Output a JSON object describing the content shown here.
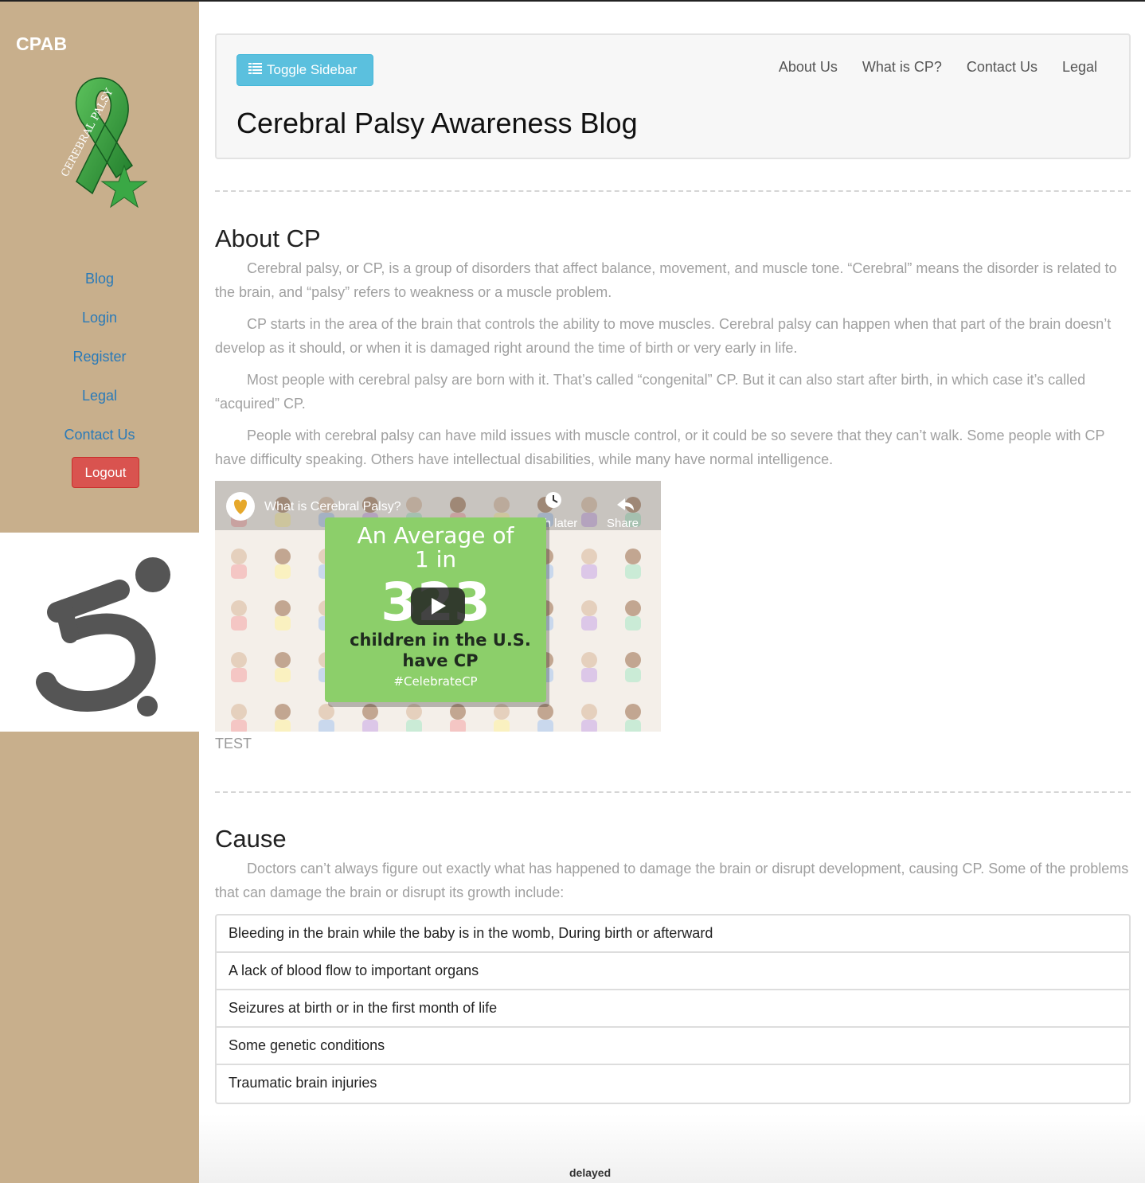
{
  "sidebar": {
    "brand": "CPAB",
    "nav": [
      {
        "label": "Blog"
      },
      {
        "label": "Login"
      },
      {
        "label": "Register"
      },
      {
        "label": "Legal"
      },
      {
        "label": "Contact Us"
      }
    ],
    "logout_label": "Logout",
    "ribbon_text": "CEREBRAL PALSY"
  },
  "header": {
    "toggle_label": "Toggle Sidebar",
    "nav": [
      "About Us",
      "What is CP?",
      "Contact Us",
      "Legal"
    ],
    "title": "Cerebral Palsy Awareness Blog"
  },
  "about": {
    "heading": "About CP",
    "paragraphs": [
      "Cerebral palsy, or CP, is a group of disorders that affect balance, movement, and muscle tone. “Cerebral” means the disorder is related to the brain, and “palsy” refers to weakness or a muscle problem.",
      "CP starts in the area of the brain that controls the ability to move muscles. Cerebral palsy can happen when that part of the brain doesn’t develop as it should, or when it is damaged right around the time of birth or very early in life.",
      "Most people with cerebral palsy are born with it. That’s called “congenital” CP. But it can also start after birth, in which case it’s called “acquired” CP.",
      "People with cerebral palsy can have mild issues with muscle control, or it could be so severe that they can’t walk. Some people with CP have difficulty speaking. Others have intellectual disabilities, while many have normal intelligence."
    ],
    "video": {
      "title": "What is Cerebral Palsy?",
      "watch_later": "Watch later",
      "share": "Share",
      "line1": "An Average of",
      "line2": "1 in",
      "number": "323",
      "line3": "children in the U.S.",
      "line4": "have CP",
      "hashtag": "#CelebrateCP"
    },
    "caption": "TEST"
  },
  "cause": {
    "heading": "Cause",
    "paragraph": "Doctors can’t always figure out exactly what has happened to damage the brain or disrupt development, causing CP. Some of the problems that can damage the brain or disrupt its growth include:",
    "items": [
      "Bleeding in the brain while the baby is in the womb, During birth or afterward",
      "A lack of blood flow to important organs",
      "Seizures at birth or in the first month of life",
      "Some genetic conditions",
      "Traumatic brain injuries"
    ]
  },
  "footer": {
    "text": "delayed"
  },
  "colors": {
    "sidebar_bg": "#c8af8c",
    "nav_link": "#2a7ab8",
    "logout": "#d9534f",
    "toggle": "#5bc0de",
    "ribbon": "#2e9e3a",
    "video_card": "#8ccf6a"
  }
}
